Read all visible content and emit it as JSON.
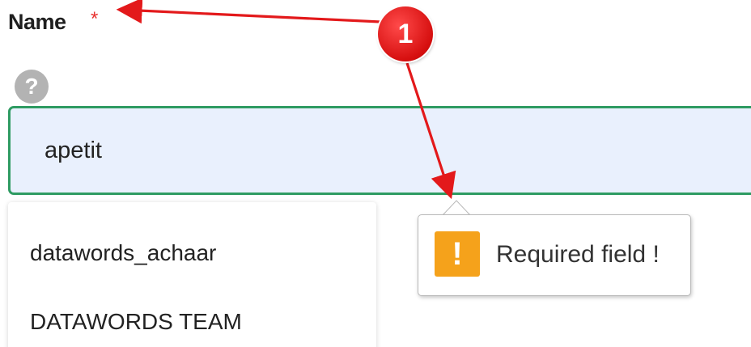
{
  "form": {
    "name_label": "Name",
    "required_marker": "*",
    "help_symbol": "?",
    "name_value": "apetit"
  },
  "autocomplete": {
    "items": [
      "datawords_achaar",
      "DATAWORDS TEAM"
    ]
  },
  "validation": {
    "icon_symbol": "!",
    "message": "Required field !"
  },
  "annotation": {
    "badge_number": "1",
    "color": "#e3191b"
  },
  "colors": {
    "input_border": "#2e9b62",
    "input_background": "#e9f0fd",
    "warning": "#f5a21b",
    "required_star": "#e8322f"
  }
}
